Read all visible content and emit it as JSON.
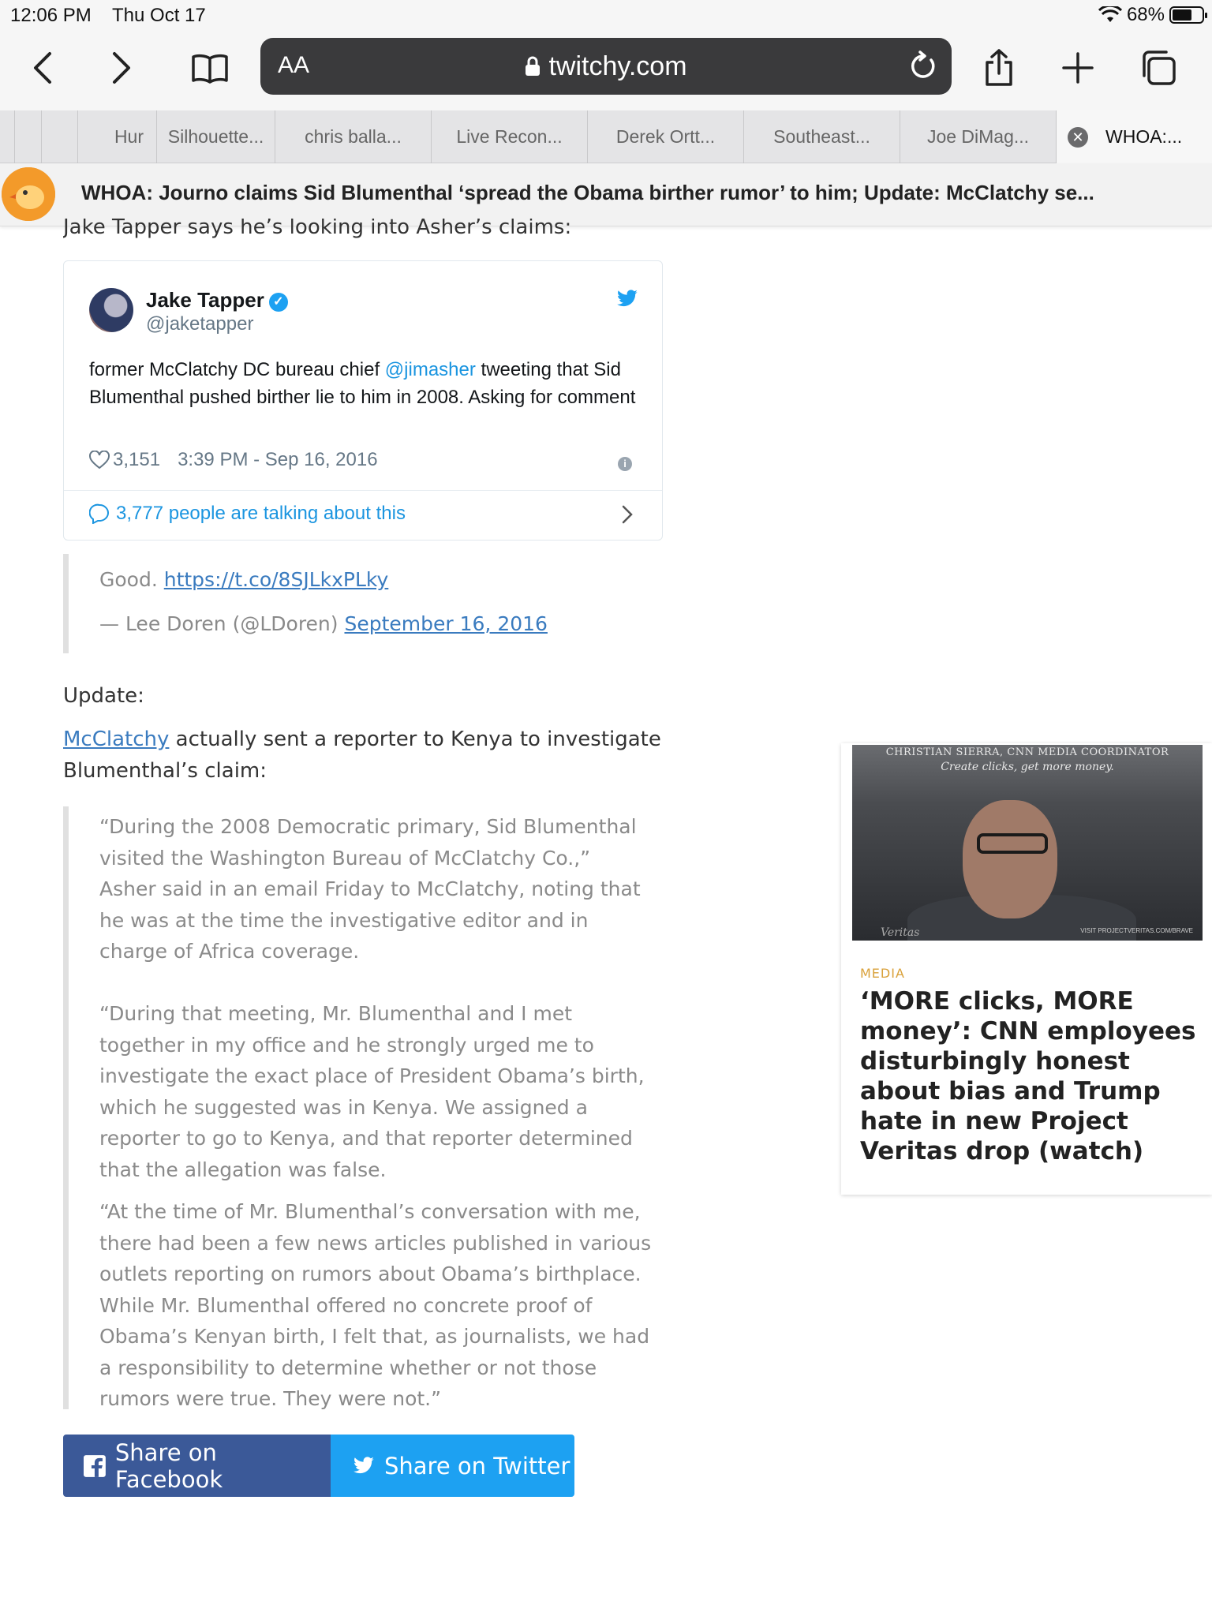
{
  "status_bar": {
    "time": "12:06 PM",
    "date": "Thu Oct 17",
    "battery": "68%"
  },
  "toolbar": {
    "text_size": "AA",
    "url_host": "twitchy.com"
  },
  "tabs": [
    {
      "label": "Hur"
    },
    {
      "label": "Silhouette..."
    },
    {
      "label": "chris balla..."
    },
    {
      "label": "Live Recon..."
    },
    {
      "label": "Derek Ortt..."
    },
    {
      "label": "Southeast..."
    },
    {
      "label": "Joe DiMag..."
    },
    {
      "label": "WHOA:..."
    }
  ],
  "site_header": {
    "title": "WHOA: Journo claims Sid Blumenthal ‘spread the Obama birther rumor’ to him; Update: McClatchy se..."
  },
  "article": {
    "intro": "Jake Tapper says he’s looking into Asher’s claims:",
    "tweet": {
      "name": "Jake Tapper",
      "handle": "@jaketapper",
      "text_before": "former McClatchy DC bureau chief ",
      "mention": "@jimasher",
      "text_after": " tweeting that Sid Blumenthal pushed birther lie to him in 2008. Asking for comment",
      "likes": "3,151",
      "timestamp": "3:39 PM - Sep 16, 2016",
      "talking": "3,777 people are talking about this"
    },
    "quote1": {
      "text": "Good. ",
      "link": "https://t.co/8SJLkxPLky",
      "attribution": "— Lee Doren (@LDoren) ",
      "date_link": "September 16, 2016"
    },
    "update_label": "Update:",
    "mcclatchy_link": "McClatchy",
    "mcclatchy_text": " actually sent a reporter to Kenya to investigate Blumenthal’s claim:",
    "quote2": [
      "“During the 2008 Democratic primary, Sid Blumenthal visited the Washington Bureau of McClatchy Co.,” Asher said in an email Friday to McClatchy, noting that he was at the time the investigative editor and in charge of Africa coverage.",
      "“During that meeting, Mr. Blumenthal and I met together in my office and he strongly urged me to investigate the exact place of President Obama’s birth, which he suggested was in Kenya. We assigned a reporter to go to Kenya, and that reporter determined that the allegation was false.",
      "“At the time of Mr. Blumenthal’s conversation with me, there had been a few news articles published in various outlets reporting on rumors about Obama’s birthplace. While Mr. Blumenthal offered no concrete proof of Obama’s Kenyan birth, I felt that, as journalists, we had a responsibility to determine whether or not those rumors were true. They were not.”"
    ],
    "share_facebook": "Share on Facebook",
    "share_twitter": "Share on Twitter"
  },
  "sidebar_card": {
    "thumb_caption_1": "CHRISTIAN SIERRA, CNN MEDIA COORDINATOR",
    "thumb_caption_2": "Create clicks, get more money.",
    "thumb_watermark_1": "Veritas",
    "thumb_watermark_2": "VISIT PROJECTVERITAS.COM/BRAVE",
    "category": "MEDIA",
    "headline": "‘MORE clicks, MORE money’: CNN employees disturbingly honest about bias and Trump hate in new Project Veritas drop (watch)"
  }
}
